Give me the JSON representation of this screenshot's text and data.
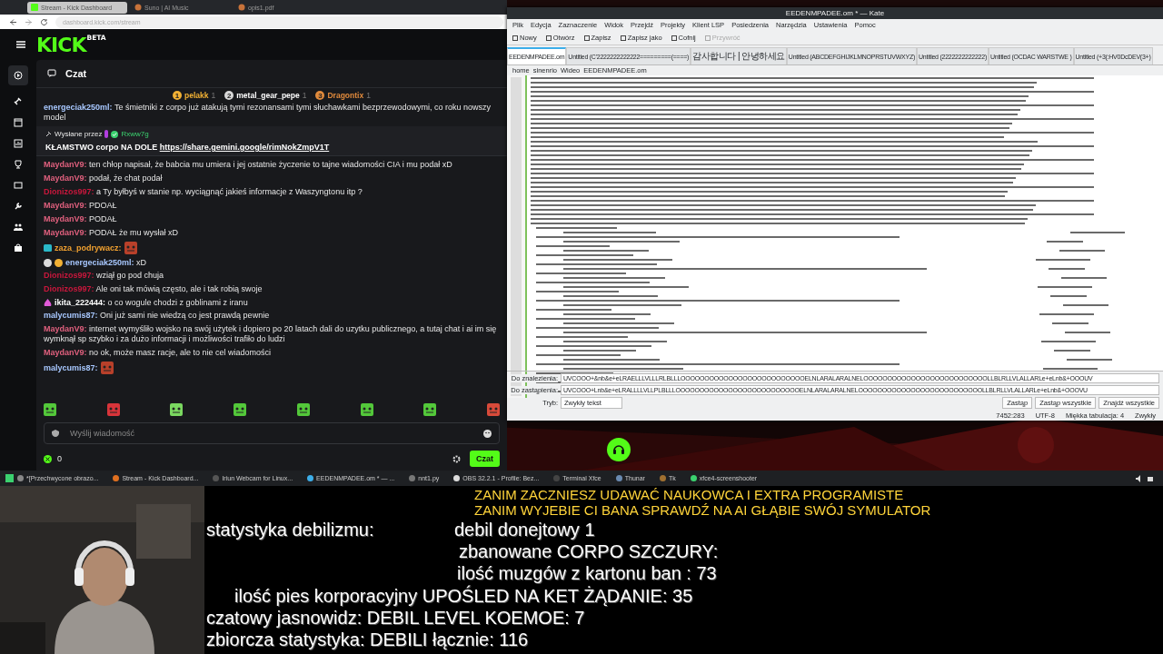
{
  "browser": {
    "tabs": [
      {
        "label": "Stream - Kick Dashboard",
        "selected": true
      },
      {
        "label": "Suno | AI Music",
        "selected": false
      },
      {
        "label": "opis1.pdf",
        "selected": false
      }
    ],
    "url": "dashboard.kick.com/stream",
    "logo": "KICK",
    "logo_badge": "BETA",
    "chat": {
      "title": "Czat",
      "leaders": [
        {
          "rank": "1",
          "name": "pelakk",
          "count": "1",
          "color": "#f2b134"
        },
        {
          "rank": "2",
          "name": "metal_gear_pepe",
          "count": "1",
          "color": "#d8d8d8"
        },
        {
          "rank": "3",
          "name": "Dragontix",
          "count": "1",
          "color": "#e08a3c"
        }
      ],
      "pinned": {
        "label": "Wysłane przez",
        "author": "Rxww7g",
        "text": "KŁAMSTWO corpo NA DOLE ",
        "link": "https://share.gemini.google/rimNokZmpV1T"
      },
      "top_message": {
        "user": "energeciak250ml:",
        "color": "#a8c8ff",
        "text": "Te śmietniki z corpo już atakują tymi rezonansami tymi słuchawkami bezprzewodowymi, co roku nowszy model"
      },
      "messages": [
        {
          "kind": "text",
          "user": "MaydanV9:",
          "color": "#e0607e",
          "text": "ten chłop napisał, że babcia mu umiera i jej ostatnie życzenie to tajne wiadomości CIA i mu podał xD"
        },
        {
          "kind": "text",
          "user": "MaydanV9:",
          "color": "#e0607e",
          "text": "podał, że chat podał"
        },
        {
          "kind": "text",
          "user": "Dionizos997:",
          "color": "#c8173c",
          "text": "a Ty byłbyś w stanie np. wyciągnąć jakieś informacje z Waszyngtonu itp ?"
        },
        {
          "kind": "text",
          "user": "MaydanV9:",
          "color": "#e0607e",
          "text": "PDOAŁ"
        },
        {
          "kind": "text",
          "user": "MaydanV9:",
          "color": "#e0607e",
          "text": "PODAŁ"
        },
        {
          "kind": "text",
          "user": "MaydanV9:",
          "color": "#e0607e",
          "text": "PODAŁ że mu wysłał xD"
        },
        {
          "kind": "emote",
          "user": "zaza_podrywacz:",
          "color": "#f0a030",
          "badges": [
            {
              "kind": "sub"
            }
          ]
        },
        {
          "kind": "text",
          "user": "energeciak250ml:",
          "color": "#a8c8ff",
          "badges": [
            {
              "kind": "og"
            },
            {
              "kind": "gift"
            }
          ],
          "text": "xD"
        },
        {
          "kind": "text",
          "user": "Dionizos997:",
          "color": "#c8173c",
          "text": "wziął go pod chuja"
        },
        {
          "kind": "text",
          "user": "Dionizos997:",
          "color": "#c8173c",
          "text": "Ale oni tak mówią często, ale i tak robią swoje"
        },
        {
          "kind": "text",
          "user": "ikita_222444:",
          "color": "#ffffff",
          "badges": [
            {
              "kind": "pink"
            }
          ],
          "text": "o co wogule chodzi z goblinami z iranu"
        },
        {
          "kind": "text",
          "user": "malycumis87:",
          "color": "#a8c8ff",
          "text": "Oni już sami nie wiedzą co jest prawdą pewnie"
        },
        {
          "kind": "text",
          "user": "MaydanV9:",
          "color": "#e0607e",
          "text": "internet wymyśliło wojsko na swój użytek i dopiero po 20 latach dali do uzytku publicznego, a tutaj chat i ai im się wymknął sp szybko i za dużo informacji i możliwości trafiło do ludzi"
        },
        {
          "kind": "text",
          "user": "MaydanV9:",
          "color": "#e0607e",
          "text": "no ok, może masz racje, ale to nie cel wiadomości"
        },
        {
          "kind": "emote",
          "user": "malycumis87:",
          "color": "#a8c8ff"
        }
      ],
      "placeholder": "Wyślij wiadomość",
      "points": "0",
      "send": "Czat"
    }
  },
  "kate": {
    "title": "EEDENMPADEE.om * — Kate",
    "menu": [
      "Plik",
      "Edycja",
      "Zaznaczenie",
      "Widok",
      "Przejdź",
      "Projekty",
      "Klient LSP",
      "Posiedzenia",
      "Narzędzia",
      "Ustawienia",
      "Pomoc"
    ],
    "toolbar": [
      {
        "label": "Nowy",
        "disabled": false
      },
      {
        "label": "Otwórz",
        "disabled": false
      },
      {
        "label": "Zapisz",
        "disabled": false
      },
      {
        "label": "Zapisz jako",
        "disabled": false
      },
      {
        "label": "Cofnij",
        "disabled": false
      },
      {
        "label": "Przywróć",
        "disabled": true
      }
    ],
    "tabs": [
      {
        "label": "EEDENMPADEE.om",
        "selected": true
      },
      {
        "label": "Untitled (C'2222222222222=========(====)",
        "selected": false
      },
      {
        "label": "감사합니다 | 안녕하세요",
        "selected": false
      },
      {
        "label": "Untitled (ABCDEFGHIJKLMNOPRSTUVWXYZ)",
        "selected": false
      },
      {
        "label": "Untitled (2222222222222)",
        "selected": false
      },
      {
        "label": "Untitled (OCDAC WARSTWE )",
        "selected": false
      },
      {
        "label": "Untitled (+3(:HV0DcDEV(3+)",
        "selected": false
      }
    ],
    "breadcrumb": [
      "home",
      "sinenrio",
      "Wideo",
      "EEDENMPADEE.om"
    ],
    "find_label": "Do znalezienia:",
    "find_value": "UVCOOO+&nb&e+eLRAELLLVLLLRLBLLLOOOOOOOOOOOOOOOOOOOOOOOOOOELNLARALARALNELOOOOOOOOOOOOOOOOOOOOOOOOOOLLBLRLLVLALLARLe+eLnb&+OOOUV",
    "replace_label": "Do zastąpienia:",
    "replace_value": "UVCOOO+Lnb&e+eLRALLLLVLLPLBLLLOOOOOOOOOOOOOOOOOOOOOOOOOOELNLARALARALNELOOOOOOOOOOOOOOOOOOOOOOOOOOLLBLRLLVLALLARLe+eLnb&+OOOVU",
    "mode_label": "Tryb:",
    "mode": "Zwykły tekst",
    "buttons": [
      "Zastąp",
      "Zastąp wszystkie",
      "Znajdź wszystkie"
    ],
    "status": [
      "7452:283",
      "UTF-8",
      "Miękka tabulacja: 4",
      "Zwykły"
    ]
  },
  "taskbar": [
    "*[Przechwycone obrazo...",
    "Stream - Kick Dashboard...",
    "Iriun Webcam for Linux...",
    "EEDENMPADEE.om * — ...",
    "nnt1.py",
    "OBS 32.2.1 - Profile: Bez...",
    "Terminal Xfce",
    "Thunar",
    "Tk",
    "xfce4-screenshooter"
  ],
  "overlay": {
    "warnings": [
      "ZANIM ZACZNIESZ UDAWAĆ NAUKOWCA I EXTRA PROGRAMISTE",
      "ZANIM WYJEBIE CI BANA SPRAWDŹ NA AI GŁĄBIE SWÓJ SYMULATOR"
    ],
    "stats": [
      "statystyka debilizmu:",
      "debil donejtowy 1",
      "zbanowane CORPO SZCZURY:",
      "ilość muzgów z kartonu ban : 73",
      "ilość pies korporacyjny UPOŚLED NA KET ŻĄDANIE: 35",
      "czatowy jasnowidz: DEBIL LEVEL KOEMOE: 7",
      "zbiorcza statystyka: DEBILI łącznie: 116"
    ]
  }
}
